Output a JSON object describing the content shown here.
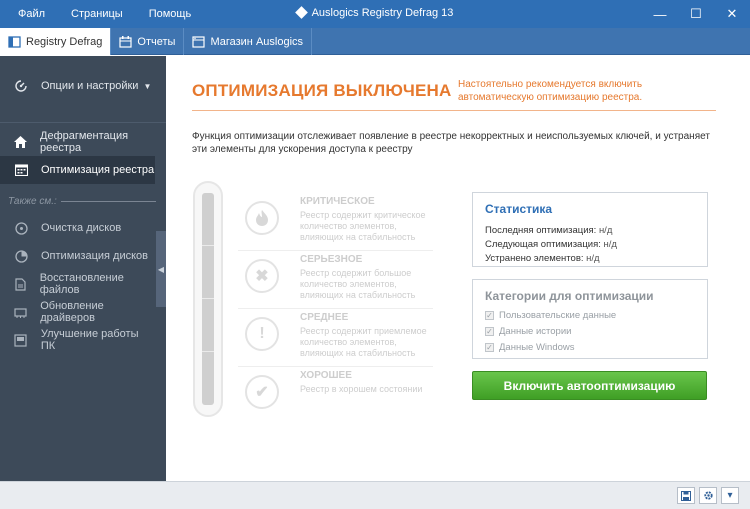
{
  "titlebar": {
    "menu": [
      "Файл",
      "Страницы",
      "Помощь"
    ],
    "title": "Auslogics Registry Defrag 13",
    "controls": {
      "minimize": "—",
      "maximize": "☐",
      "close": "✕"
    }
  },
  "tabs": [
    {
      "label": "Registry Defrag",
      "icon": "registry-icon",
      "active": true
    },
    {
      "label": "Отчеты",
      "icon": "reports-icon",
      "active": false
    },
    {
      "label": "Магазин Auslogics",
      "icon": "store-icon",
      "active": false
    }
  ],
  "sidebar": {
    "options_label": "Опции и настройки",
    "items": [
      {
        "label": "Дефрагментация реестра",
        "icon": "home-icon"
      },
      {
        "label": "Оптимизация реестра",
        "icon": "calendar-icon",
        "active": true
      }
    ],
    "also_label": "Также см.:",
    "also_items": [
      {
        "label": "Очистка дисков",
        "icon": "disk-clean-icon"
      },
      {
        "label": "Оптимизация дисков",
        "icon": "disk-optimize-icon"
      },
      {
        "label": "Восстановление файлов",
        "icon": "file-restore-icon"
      },
      {
        "label": "Обновление драйверов",
        "icon": "driver-update-icon"
      },
      {
        "label": "Улучшение работы ПК",
        "icon": "pc-boost-icon"
      }
    ]
  },
  "main": {
    "heading": "ОПТИМИЗАЦИЯ ВЫКЛЮЧЕНА",
    "hint": "Настоятельно рекомендуется включить автоматическую оптимизацию реестра.",
    "description": "Функция оптимизации отслеживает появление в реестре некорректных и неиспользуемых ключей, и устраняет эти элементы для ускорения доступа к реестру",
    "levels": [
      {
        "title": "КРИТИЧЕСКОЕ",
        "text": "Реестр содержит критическое количество элементов, влияющих на стабильность",
        "icon": "fire-icon"
      },
      {
        "title": "СЕРЬЕЗНОЕ",
        "text": "Реестр содержит большое количество элементов, влияющих на стабильность",
        "icon": "x-icon"
      },
      {
        "title": "СРЕДНЕЕ",
        "text": "Реестр содержит приемлемое количество элементов, влияющих на стабильность",
        "icon": "exclamation-icon"
      },
      {
        "title": "ХОРОШЕЕ",
        "text": "Реестр в хорошем состоянии",
        "icon": "check-icon"
      }
    ],
    "stats": {
      "title": "Статистика",
      "last_label": "Последняя оптимизация:",
      "last_value": "н/д",
      "next_label": "Следующая оптимизация:",
      "next_value": "н/д",
      "fixed_label": "Устранено элементов:",
      "fixed_value": "н/д"
    },
    "categories": {
      "title": "Категории для оптимизации",
      "items": [
        "Пользовательские данные",
        "Данные истории",
        "Данные Windows"
      ]
    },
    "enable_button": "Включить автооптимизацию"
  },
  "bottombar": {
    "buttons": [
      "save-icon",
      "settings-icon",
      "menu-icon"
    ]
  }
}
